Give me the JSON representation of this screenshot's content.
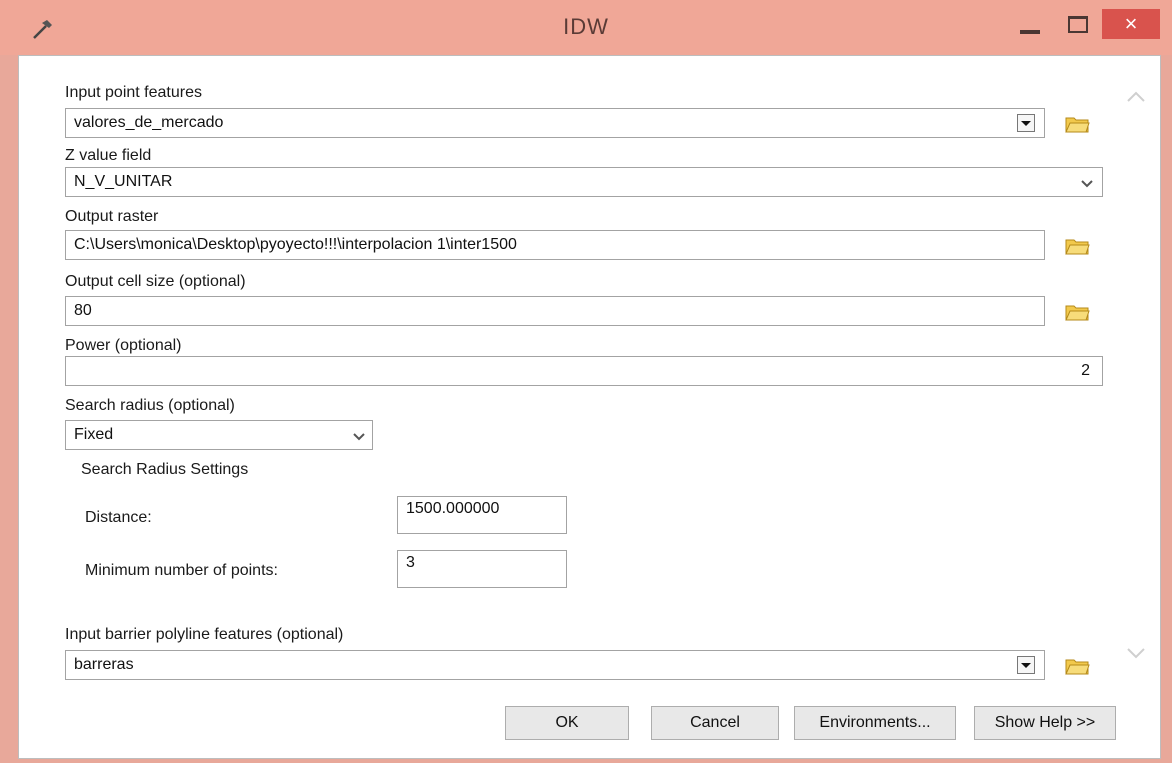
{
  "window": {
    "title": "IDW",
    "close_glyph": "×",
    "accent_color": "#f0a797",
    "close_color": "#d9534d"
  },
  "fields": {
    "input_point_features": {
      "label": "Input point features",
      "value": "valores_de_mercado"
    },
    "z_value_field": {
      "label": "Z value field",
      "value": "N_V_UNITAR"
    },
    "output_raster": {
      "label": "Output raster",
      "value": "C:\\Users\\monica\\Desktop\\pyoyecto!!!\\interpolacion 1\\inter1500"
    },
    "output_cell_size": {
      "label": "Output cell size (optional)",
      "value": "80"
    },
    "power": {
      "label": "Power (optional)",
      "value": "2"
    },
    "search_radius": {
      "label": "Search radius (optional)",
      "value": "Fixed"
    },
    "search_radius_settings": {
      "heading": "Search Radius Settings",
      "distance_label": "Distance:",
      "distance_value": "1500.000000",
      "min_points_label": "Minimum number of points:",
      "min_points_value": "3"
    },
    "input_barrier": {
      "label": "Input barrier polyline features (optional)",
      "value": "barreras"
    }
  },
  "buttons": {
    "ok": "OK",
    "cancel": "Cancel",
    "environments": "Environments...",
    "show_help": "Show Help >>"
  },
  "icons": [
    "hammer-icon",
    "minimize-icon",
    "maximize-icon",
    "close-icon",
    "folder-open-icon",
    "dropdown-arrow-icon",
    "chevron-down-icon",
    "scroll-up-icon",
    "scroll-down-icon"
  ]
}
